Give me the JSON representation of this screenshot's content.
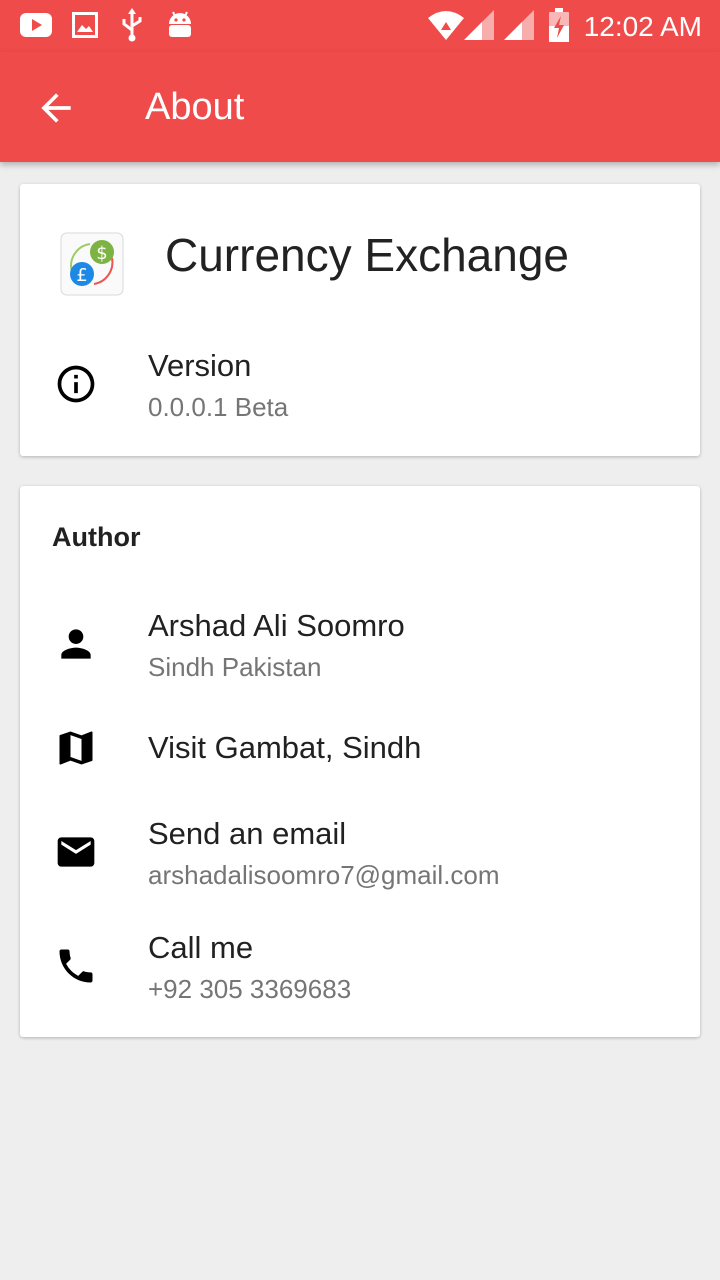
{
  "status_bar": {
    "time": "12:02 AM",
    "icons": [
      "youtube-icon",
      "gallery-icon",
      "usb-icon",
      "android-icon",
      "wifi-icon",
      "signal-icon",
      "signal-icon",
      "battery-charging-icon"
    ]
  },
  "app_bar": {
    "title": "About",
    "back_icon": "arrow-back-icon",
    "color": "#ef4b4b"
  },
  "app_card": {
    "app_name": "Currency Exchange",
    "logo_icon": "currency-exchange-logo",
    "version_label": "Version",
    "version_value": "0.0.0.1 Beta",
    "version_icon": "info-icon"
  },
  "author_card": {
    "section_title": "Author",
    "items": [
      {
        "icon": "person-icon",
        "primary": "Arshad Ali Soomro",
        "secondary": "Sindh Pakistan"
      },
      {
        "icon": "map-icon",
        "primary": "Visit Gambat, Sindh",
        "secondary": ""
      },
      {
        "icon": "email-icon",
        "primary": "Send an email",
        "secondary": "arshadalisoomro7@gmail.com"
      },
      {
        "icon": "phone-icon",
        "primary": "Call me",
        "secondary": "+92 305 3369683"
      }
    ]
  }
}
